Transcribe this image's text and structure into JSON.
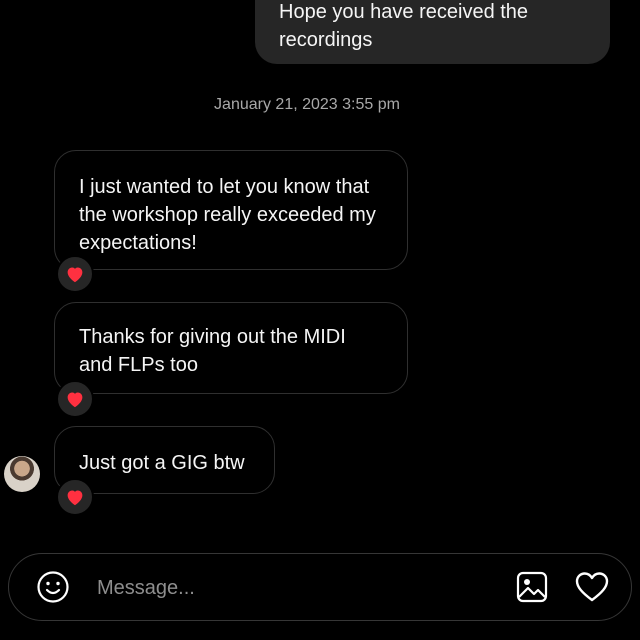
{
  "thread": {
    "sent_message": "Hope you have received the recordings",
    "timestamp": "January 21, 2023 3:55 pm",
    "received_messages": [
      {
        "text": "I just wanted to let you know that the workshop really exceeded my expectations!",
        "reaction": "heart"
      },
      {
        "text": "Thanks for giving out the MIDI and FLPs too",
        "reaction": "heart"
      },
      {
        "text": "Just got a GIG btw",
        "reaction": "heart"
      }
    ]
  },
  "composer": {
    "placeholder": "Message...",
    "emoji_icon": "smiley-icon",
    "image_icon": "image-icon",
    "like_icon": "heart-outline-icon"
  },
  "colors": {
    "background": "#000000",
    "sent_bubble": "#262626",
    "received_border": "#2f2f2f",
    "timestamp": "#a8a8a8",
    "reaction_heart": "#ff3040",
    "placeholder": "#8e8e8e"
  }
}
